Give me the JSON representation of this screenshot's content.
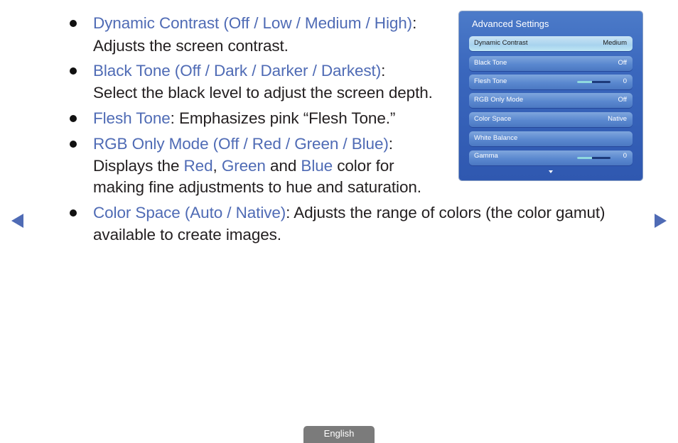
{
  "items": [
    {
      "term": "Dynamic Contrast (Off / Low / Medium / High)",
      "sep": ":",
      "desc_lines": [
        "Adjusts the screen contrast."
      ]
    },
    {
      "term": "Black Tone (Off / Dark / Darker / Darkest)",
      "sep": ":",
      "desc_lines": [
        "Select the black level to adjust the screen depth."
      ]
    },
    {
      "term": "Flesh Tone",
      "sep": ": Emphasizes pink “Flesh Tone.”",
      "desc_lines": []
    },
    {
      "term": "RGB Only Mode (Off / Red / Green / Blue)",
      "sep": ":",
      "desc_pre": "Displays the ",
      "red": "Red",
      "comma": ", ",
      "green": "Green",
      "and": " and ",
      "blue": "Blue",
      "desc_post": " color for",
      "desc_line2": "making fine adjustments to hue and saturation."
    },
    {
      "term": "Color Space (Auto / Native)",
      "sep": ": Adjusts the range of colors (the color gamut)",
      "desc_lines": [
        "available to create images."
      ]
    }
  ],
  "panel": {
    "title": "Advanced Settings",
    "rows": [
      {
        "label": "Dynamic Contrast",
        "value": "Medium",
        "selected": true
      },
      {
        "label": "Black Tone",
        "value": "Off"
      },
      {
        "label": "Flesh Tone",
        "value": "0",
        "slider_fraction": 0.45
      },
      {
        "label": "RGB Only Mode",
        "value": "Off"
      },
      {
        "label": "Color Space",
        "value": "Native"
      },
      {
        "label": "White Balance",
        "value": ""
      },
      {
        "label": "Gamma",
        "value": "0",
        "slider_fraction": 0.45
      }
    ],
    "more_icon": "triangle-down"
  },
  "nav": {
    "prev_icon": "triangle-left",
    "next_icon": "triangle-right"
  },
  "footer": {
    "language_label": "English"
  },
  "colors": {
    "accent": "#4f6bb5",
    "text": "#231f20",
    "panel": "#3a67bd",
    "footer_button": "#7b7b7b"
  }
}
